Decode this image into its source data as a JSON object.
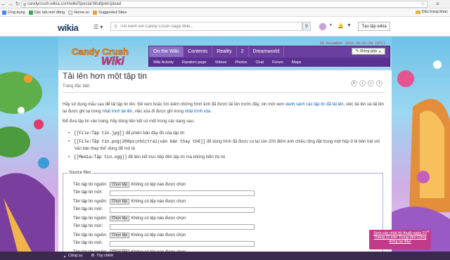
{
  "browser": {
    "url": "candycrush.wikia.com/wiki/Special:MultipleUpload",
    "back_icon": "arrow-left-icon",
    "forward_icon": "arrow-right-icon",
    "reload_icon": "reload-icon"
  },
  "bookmarks": {
    "items": [
      "Ứng dụng",
      "Các tab mới đóng",
      "Home.vn",
      "Suggested Sites"
    ],
    "right_label": "Dấu trang khác"
  },
  "wikia_header": {
    "logo": "wikia",
    "search_placeholder": "Tìm kiếm với Candy Crush Saga Wiki...",
    "create_label": "Tạo tập wikia"
  },
  "wiki": {
    "logo_text_1": "Candy Crush",
    "logo_text_2": "Wiki",
    "timestamp": "26 November 2015 06:41:59 (UTC)",
    "nav_tabs": [
      "On the Wiki",
      "Contents",
      "Reality",
      "2",
      "Dreamworld"
    ],
    "nav_subtabs": [
      "Wiki Activity",
      "Random page",
      "Videos",
      "Photos",
      "Chat",
      "Forum",
      "Maps"
    ],
    "contribute_label": "Đóng góp"
  },
  "article": {
    "title": "Tải lên hơn một tập tin",
    "subtitle": "Trang đặc biệt",
    "p1_a": "Hãy sử dụng mẫu sau để tải tập tin lên. Để xem hoặc tìm kiếm những hình ảnh đã được tải lên trước đây, xin mời xem ",
    "p1_link1": "danh sách các tập tin đã tải lên",
    "p1_b": ", việc tải lên và tải lên lại được ghi lại trong ",
    "p1_link2": "nhật trình tải lên",
    "p1_c": ", việc xóa đi được ghi trong ",
    "p1_link3": "nhật trình xóa",
    "p1_d": ".",
    "p2": "Để đưa tập tin vào trang, hãy dùng liên kết có một trong các dạng sau:",
    "list": [
      {
        "code": "[[File:Tập tin.jpg]]",
        "desc": " để phiên bản đầy đủ của tập tin"
      },
      {
        "code": "[[File:Tập tin.png|200px|nhỏ|trái|văn bản thay thế]]",
        "desc": " để dùng hình đã được co lại còn 200 điểm ảnh chiều rộng đặt trong một hộp ở lề bên trái với 'văn bản thay thế' dùng để mô tả"
      },
      {
        "code": "[[Media:Tập tin.ogg]]",
        "desc": " để liên kết trực tiếp đến tập tin mà không hiển thị nó"
      }
    ]
  },
  "upload_form": {
    "legend": "Source files",
    "source_label": "Tên tập tin nguồn:",
    "choose_label": "Chọn tệp",
    "no_file": "Không có tệp nào được chọn",
    "new_name_label": "Tên tập tin mới:"
  },
  "bottom": {
    "tools": "Công cụ",
    "customize": "Tùy chỉnh"
  },
  "promo": {
    "text": "Xem các nhật ký thuật ngày 23 Tháng 11 trên Trung tâm Cộng đồng tại đây!"
  },
  "colors": {
    "nav_purple": "#6b3fa0",
    "link_blue": "#0b5fb0",
    "bottom_bar": "#3b2a4e",
    "promo": "#c23b8a"
  }
}
